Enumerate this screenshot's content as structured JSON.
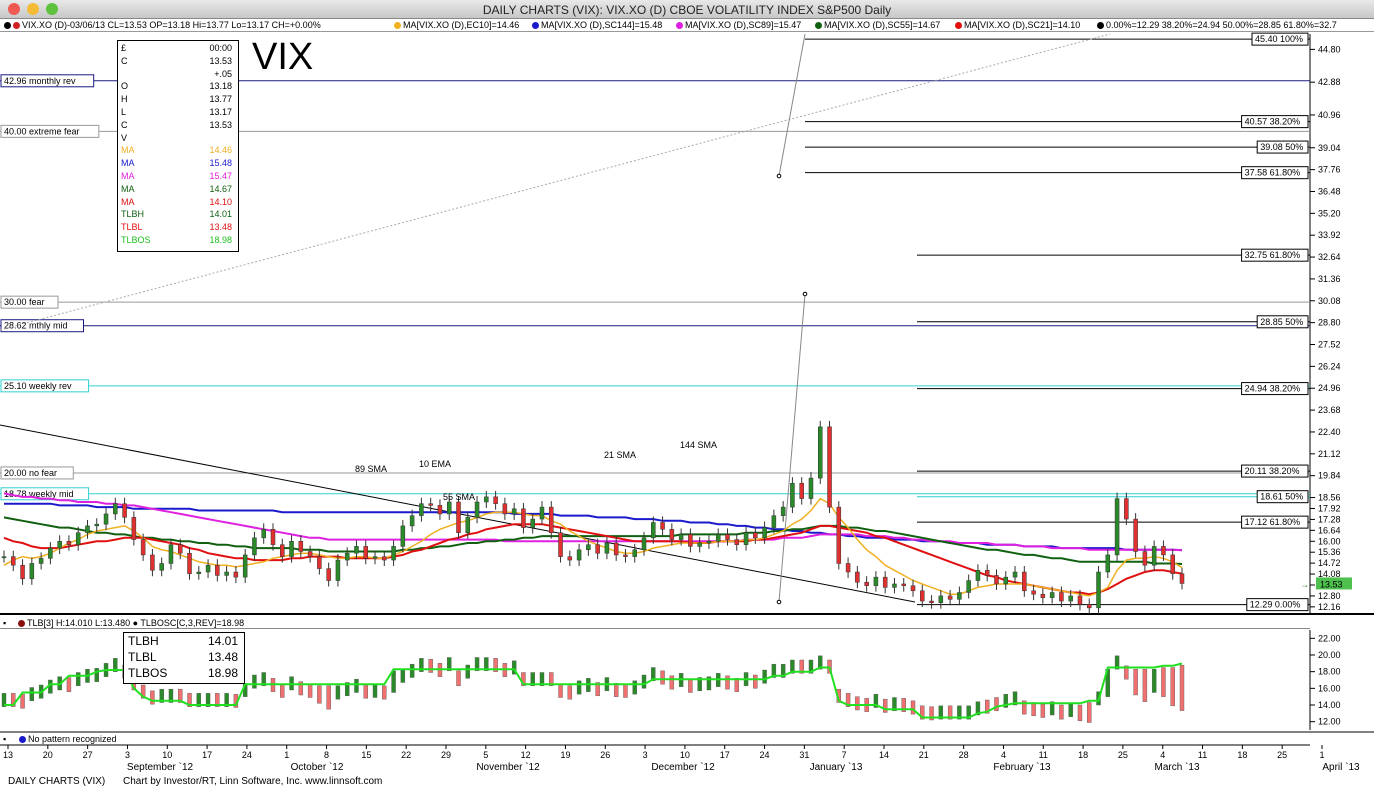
{
  "window": {
    "title": "DAILY CHARTS (VIX): VIX.XO (D) CBOE VOLATILITY INDEX S&P500 Daily"
  },
  "infobar": {
    "quote": "VIX.XO (D)-03/06/13 CL=13.53 OP=13.18 Hi=13.77 Lo=13.17 CH=+0.00%",
    "ma1": "MA[VIX.XO (D),EC10]=14.46",
    "ma2": "MA[VIX.XO (D),SC144]=15.48",
    "ma3": "MA[VIX.XO (D),SC89]=15.47",
    "ma4": "MA[VIX.XO (D),SC55]=14.67",
    "ma5": "MA[VIX.XO (D),SC21]=14.10",
    "fib": "0.00%=12.29 38.20%=24.94 50.00%=28.85 61.80%=32.7"
  },
  "big_label": "VIX",
  "data_panel": {
    "rows": [
      {
        "label": "£",
        "value": "00:00",
        "color": "#000000"
      },
      {
        "label": "C",
        "value": "13.53",
        "color": "#000000"
      },
      {
        "label": "",
        "value": "+.05",
        "color": "#000000"
      },
      {
        "label": "O",
        "value": "13.18",
        "color": "#000000"
      },
      {
        "label": "H",
        "value": "13.77",
        "color": "#000000"
      },
      {
        "label": "L",
        "value": "13.17",
        "color": "#000000"
      },
      {
        "label": "C",
        "value": "13.53",
        "color": "#000000"
      },
      {
        "label": "V",
        "value": "",
        "color": "#000000"
      },
      {
        "label": "MA",
        "value": "14.46",
        "color": "#f0b020"
      },
      {
        "label": "MA",
        "value": "15.48",
        "color": "#1a1acc"
      },
      {
        "label": "MA",
        "value": "15.47",
        "color": "#e020e0"
      },
      {
        "label": "MA",
        "value": "14.67",
        "color": "#106010"
      },
      {
        "label": "MA",
        "value": "14.10",
        "color": "#e01010"
      },
      {
        "label": "TLBH",
        "value": "14.01",
        "color": "#106010"
      },
      {
        "label": "TLBL",
        "value": "13.48",
        "color": "#e01010"
      },
      {
        "label": "TLBOS",
        "value": "18.98",
        "color": "#20c020"
      }
    ]
  },
  "sub_panel": {
    "header": "TLB[3] H:14.010 L:13.480 ● TLBOSC[C,3,REV]=18.98",
    "values": [
      {
        "label": "TLBH",
        "value": "14.01"
      },
      {
        "label": "TLBL",
        "value": "13.48"
      },
      {
        "label": "TLBOS",
        "value": "18.98"
      }
    ]
  },
  "pattern_status": "No pattern recognized",
  "footer": {
    "left": "DAILY CHARTS (VIX)",
    "credit": "Chart by Investor/RT, Linn Software, Inc. www.linnsoft.com"
  },
  "colors": {
    "up": "#2a8a2a",
    "down": "#e03030",
    "ma10": "#f0b020",
    "ma144": "#1a1acc",
    "ma89": "#e020e0",
    "ma55": "#106010",
    "ma21": "#e01010",
    "cyan": "#2fd0d0",
    "tlbos": "#20e020"
  },
  "chart_data": {
    "type": "candlestick",
    "title": "DAILY CHARTS (VIX): VIX.XO (D) CBOE VOLATILITY INDEX S&P500 Daily",
    "y_ticks": [
      "44.80",
      "42.88",
      "40.96",
      "39.04",
      "37.76",
      "36.48",
      "35.20",
      "33.92",
      "32.64",
      "31.36",
      "30.08",
      "28.80",
      "27.52",
      "26.24",
      "24.96",
      "23.68",
      "22.40",
      "21.12",
      "19.84",
      "18.56",
      "17.92",
      "17.28",
      "16.64",
      "16.00",
      "15.36",
      "14.72",
      "14.08",
      "13.44",
      "12.80",
      "12.16"
    ],
    "ylim": [
      11.8,
      45.7
    ],
    "last_value": "13.53",
    "x_day_ticks": [
      "13",
      "20",
      "27",
      "3",
      "10",
      "17",
      "24",
      "1",
      "8",
      "15",
      "22",
      "29",
      "5",
      "12",
      "19",
      "26",
      "3",
      "10",
      "17",
      "24",
      "31",
      "7",
      "14",
      "21",
      "28",
      "4",
      "11",
      "18",
      "25",
      "4",
      "11",
      "18",
      "25",
      "1"
    ],
    "x_month_labels": [
      "September `12",
      "October `12",
      "November `12",
      "December `12",
      "January `13",
      "February `13",
      "March `13",
      "April `13"
    ],
    "left_levels": [
      {
        "label": "42.96 monthly rev",
        "value": 42.96
      },
      {
        "label": "40.00 extreme fear",
        "value": 40.0
      },
      {
        "label": "30.00 fear",
        "value": 30.0
      },
      {
        "label": "28.62 mthly mid",
        "value": 28.62
      },
      {
        "label": "25.10 weekly rev",
        "value": 25.1
      },
      {
        "label": "20.00 no fear",
        "value": 20.0
      },
      {
        "label": "18.78 weekly mid",
        "value": 18.78
      }
    ],
    "fib_levels": [
      {
        "label": "45.40 100%",
        "value": 45.4
      },
      {
        "label": "40.57 38.20%",
        "value": 40.57
      },
      {
        "label": "39.08 50%",
        "value": 39.08
      },
      {
        "label": "37.58 61.80%",
        "value": 37.58
      },
      {
        "label": "32.75 61.80%",
        "value": 32.75
      },
      {
        "label": "28.85 50%",
        "value": 28.85
      },
      {
        "label": "24.94 38.20%",
        "value": 24.94
      },
      {
        "label": "20.11 38.20%",
        "value": 20.11
      },
      {
        "label": "18.61 50%",
        "value": 18.61
      },
      {
        "label": "17.12 61.80%",
        "value": 17.12
      },
      {
        "label": "12.29 0.00%",
        "value": 12.29
      }
    ],
    "annotations": [
      "89 SMA",
      "10 EMA",
      "55 SMA",
      "21 SMA",
      "144 SMA"
    ],
    "close_series": [
      15.1,
      14.6,
      13.8,
      14.7,
      15.0,
      15.6,
      16.0,
      15.8,
      16.5,
      16.9,
      17.0,
      17.6,
      18.2,
      17.4,
      16.1,
      15.2,
      14.3,
      14.7,
      15.8,
      15.3,
      14.1,
      14.2,
      14.6,
      14.0,
      14.2,
      13.9,
      15.2,
      16.2,
      16.7,
      15.8,
      15.1,
      16.0,
      15.4,
      15.1,
      14.4,
      13.7,
      14.9,
      15.3,
      15.7,
      15.0,
      15.1,
      14.9,
      15.7,
      16.9,
      17.5,
      18.2,
      18.1,
      17.6,
      18.3,
      16.5,
      17.4,
      18.3,
      18.6,
      18.2,
      17.6,
      17.9,
      16.8,
      17.3,
      18.0,
      16.5,
      15.1,
      14.9,
      15.5,
      15.8,
      15.3,
      15.9,
      15.2,
      15.1,
      15.5,
      16.2,
      17.1,
      16.7,
      16.1,
      16.4,
      15.7,
      15.9,
      16.0,
      16.4,
      16.1,
      15.8,
      16.5,
      16.2,
      16.8,
      17.5,
      18.0,
      19.4,
      18.5,
      19.7,
      22.7,
      18.0,
      14.7,
      14.2,
      13.6,
      13.4,
      13.9,
      13.3,
      13.5,
      13.4,
      13.1,
      12.5,
      12.4,
      12.8,
      12.6,
      13.0,
      13.7,
      14.3,
      14.0,
      13.5,
      13.9,
      14.2,
      13.1,
      12.9,
      12.7,
      13.0,
      12.5,
      12.8,
      12.3,
      12.1,
      14.2,
      15.2,
      18.5,
      17.3,
      15.4,
      14.6,
      15.7,
      15.2,
      14.1,
      13.53
    ],
    "ma10": [
      14.6,
      14.9,
      15.1,
      15.0,
      15.1,
      15.3,
      15.6,
      15.9,
      16.1,
      16.4,
      16.6,
      16.7,
      16.8,
      16.9,
      16.6,
      16.2,
      15.7,
      15.5,
      15.4,
      15.2,
      15.0,
      14.8,
      14.7,
      14.6,
      14.6,
      14.5,
      14.6,
      14.7,
      14.8,
      15.0,
      15.1,
      15.2,
      15.3,
      15.3,
      15.2,
      15.1,
      15.0,
      15.0,
      15.1,
      15.1,
      15.0,
      15.0,
      15.2,
      15.4,
      15.7,
      16.0,
      16.4,
      16.7,
      16.9,
      17.1,
      17.2,
      17.4,
      17.6,
      17.7,
      17.7,
      17.7,
      17.6,
      17.5,
      17.5,
      17.2,
      17.0,
      16.6,
      16.3,
      16.0,
      15.8,
      15.6,
      15.4,
      15.3,
      15.3,
      15.4,
      15.6,
      15.7,
      15.8,
      15.9,
      15.9,
      15.9,
      15.9,
      16.0,
      16.0,
      16.0,
      16.1,
      16.1,
      16.2,
      16.4,
      16.6,
      17.0,
      17.3,
      17.8,
      18.5,
      18.2,
      17.4,
      16.8,
      16.1,
      15.5,
      15.1,
      14.6,
      14.3,
      14.0,
      13.7,
      13.5,
      13.3,
      13.1,
      12.9,
      12.9,
      13.1,
      13.3,
      13.4,
      13.5,
      13.5,
      13.5,
      13.5,
      13.4,
      13.3,
      13.2,
      13.1,
      13.0,
      12.9,
      12.8,
      13.0,
      13.3,
      14.3,
      14.9,
      15.0,
      15.0,
      15.1,
      15.0,
      14.8,
      14.46
    ],
    "ma21": [
      16.2,
      16.0,
      15.9,
      15.7,
      15.6,
      15.6,
      15.6,
      15.7,
      15.8,
      15.9,
      16.0,
      16.0,
      16.1,
      16.2,
      16.2,
      16.2,
      16.1,
      16.0,
      15.9,
      15.8,
      15.6,
      15.5,
      15.3,
      15.2,
      15.1,
      15.0,
      15.0,
      14.9,
      14.9,
      14.9,
      14.9,
      15.0,
      15.0,
      15.1,
      15.1,
      15.1,
      15.1,
      15.0,
      15.0,
      15.0,
      15.0,
      15.0,
      15.1,
      15.2,
      15.4,
      15.5,
      15.7,
      15.9,
      16.1,
      16.2,
      16.4,
      16.5,
      16.7,
      16.8,
      16.9,
      17.0,
      17.0,
      17.0,
      17.0,
      16.9,
      16.8,
      16.7,
      16.6,
      16.5,
      16.4,
      16.3,
      16.2,
      16.1,
      16.0,
      16.0,
      16.0,
      16.0,
      16.0,
      16.0,
      15.9,
      15.9,
      15.9,
      16.0,
      16.0,
      16.0,
      16.0,
      16.1,
      16.1,
      16.2,
      16.3,
      16.4,
      16.5,
      16.7,
      16.9,
      16.9,
      16.8,
      16.7,
      16.6,
      16.5,
      16.3,
      16.2,
      16.0,
      15.8,
      15.6,
      15.4,
      15.2,
      15.0,
      14.8,
      14.6,
      14.4,
      14.2,
      14.0,
      13.9,
      13.7,
      13.6,
      13.5,
      13.4,
      13.3,
      13.2,
      13.1,
      13.0,
      13.0,
      12.9,
      13.0,
      13.2,
      13.5,
      13.8,
      14.0,
      14.2,
      14.3,
      14.3,
      14.2,
      14.1
    ],
    "ma55": [
      17.4,
      17.3,
      17.2,
      17.1,
      17.0,
      16.9,
      16.8,
      16.8,
      16.7,
      16.6,
      16.5,
      16.5,
      16.4,
      16.4,
      16.3,
      16.2,
      16.2,
      16.1,
      16.1,
      16.0,
      16.0,
      15.9,
      15.9,
      15.8,
      15.8,
      15.7,
      15.7,
      15.6,
      15.6,
      15.6,
      15.6,
      15.6,
      15.5,
      15.5,
      15.5,
      15.4,
      15.4,
      15.4,
      15.4,
      15.4,
      15.4,
      15.4,
      15.4,
      15.5,
      15.5,
      15.6,
      15.6,
      15.7,
      15.7,
      15.8,
      15.9,
      15.9,
      16.0,
      16.0,
      16.1,
      16.1,
      16.2,
      16.2,
      16.3,
      16.3,
      16.3,
      16.3,
      16.3,
      16.3,
      16.3,
      16.3,
      16.3,
      16.3,
      16.3,
      16.3,
      16.3,
      16.3,
      16.3,
      16.4,
      16.4,
      16.4,
      16.4,
      16.4,
      16.4,
      16.4,
      16.5,
      16.5,
      16.5,
      16.6,
      16.6,
      16.7,
      16.7,
      16.8,
      16.9,
      16.9,
      16.9,
      16.8,
      16.8,
      16.7,
      16.6,
      16.6,
      16.5,
      16.4,
      16.3,
      16.2,
      16.1,
      16.0,
      15.9,
      15.8,
      15.7,
      15.6,
      15.5,
      15.5,
      15.4,
      15.3,
      15.2,
      15.2,
      15.1,
      15.0,
      15.0,
      14.9,
      14.8,
      14.8,
      14.8,
      14.8,
      14.8,
      14.8,
      14.8,
      14.8,
      14.7,
      14.7,
      14.7,
      14.67
    ],
    "ma89": [
      18.8,
      18.7,
      18.6,
      18.6,
      18.5,
      18.5,
      18.4,
      18.4,
      18.3,
      18.3,
      18.3,
      18.2,
      18.2,
      18.1,
      18.1,
      18.0,
      17.9,
      17.8,
      17.7,
      17.6,
      17.5,
      17.4,
      17.3,
      17.2,
      17.1,
      17.0,
      16.9,
      16.8,
      16.7,
      16.6,
      16.5,
      16.4,
      16.3,
      16.2,
      16.2,
      16.1,
      16.1,
      16.1,
      16.1,
      16.1,
      16.1,
      16.1,
      16.1,
      16.1,
      16.1,
      16.1,
      16.1,
      16.1,
      16.1,
      16.1,
      16.1,
      16.1,
      16.1,
      16.1,
      16.0,
      16.0,
      16.0,
      16.0,
      16.0,
      16.0,
      16.0,
      16.0,
      16.0,
      16.0,
      16.0,
      16.0,
      16.0,
      16.0,
      16.0,
      16.0,
      16.0,
      16.0,
      16.0,
      16.0,
      16.0,
      16.0,
      16.0,
      16.0,
      16.0,
      16.0,
      16.1,
      16.1,
      16.1,
      16.1,
      16.2,
      16.2,
      16.2,
      16.3,
      16.4,
      16.4,
      16.4,
      16.4,
      16.4,
      16.3,
      16.3,
      16.3,
      16.2,
      16.2,
      16.1,
      16.1,
      16.0,
      16.0,
      16.0,
      15.9,
      15.9,
      15.9,
      15.9,
      15.8,
      15.8,
      15.8,
      15.7,
      15.7,
      15.7,
      15.6,
      15.6,
      15.6,
      15.6,
      15.5,
      15.5,
      15.5,
      15.5,
      15.5,
      15.5,
      15.5,
      15.5,
      15.5,
      15.5,
      15.47
    ],
    "ma144": [
      18.2,
      18.2,
      18.2,
      18.2,
      18.2,
      18.2,
      18.1,
      18.1,
      18.1,
      18.1,
      18.0,
      18.0,
      18.0,
      18.0,
      17.9,
      17.9,
      17.9,
      17.9,
      17.9,
      17.9,
      17.9,
      17.8,
      17.8,
      17.8,
      17.8,
      17.8,
      17.8,
      17.8,
      17.8,
      17.8,
      17.7,
      17.7,
      17.7,
      17.7,
      17.7,
      17.7,
      17.7,
      17.7,
      17.7,
      17.7,
      17.7,
      17.7,
      17.7,
      17.7,
      17.7,
      17.7,
      17.7,
      17.7,
      17.7,
      17.7,
      17.7,
      17.7,
      17.7,
      17.7,
      17.7,
      17.6,
      17.6,
      17.6,
      17.6,
      17.6,
      17.5,
      17.5,
      17.5,
      17.5,
      17.4,
      17.4,
      17.4,
      17.4,
      17.3,
      17.3,
      17.3,
      17.2,
      17.2,
      17.2,
      17.1,
      17.1,
      17.1,
      17.0,
      17.0,
      16.9,
      16.9,
      16.8,
      16.8,
      16.7,
      16.7,
      16.6,
      16.6,
      16.5,
      16.5,
      16.4,
      16.4,
      16.3,
      16.3,
      16.2,
      16.2,
      16.2,
      16.1,
      16.1,
      16.1,
      16.0,
      16.0,
      16.0,
      15.9,
      15.9,
      15.9,
      15.9,
      15.8,
      15.8,
      15.8,
      15.8,
      15.7,
      15.7,
      15.7,
      15.7,
      15.6,
      15.6,
      15.6,
      15.6,
      15.6,
      15.6,
      15.6,
      15.5,
      15.5,
      15.5,
      15.5,
      15.5,
      15.5,
      15.48
    ],
    "tlb_y_ticks": [
      "22.00",
      "20.00",
      "18.00",
      "16.00",
      "14.00",
      "12.00"
    ],
    "tlb_ylim": [
      11.0,
      23.0
    ],
    "tlbos_series": [
      14.0,
      14.0,
      15.5,
      15.5,
      15.5,
      16.5,
      16.5,
      17.5,
      17.5,
      17.5,
      18.0,
      18.2,
      18.2,
      18.2,
      16.0,
      15.0,
      14.5,
      14.5,
      14.5,
      14.5,
      14.0,
      14.0,
      14.0,
      14.0,
      14.0,
      14.0,
      16.5,
      16.5,
      16.5,
      16.5,
      16.5,
      16.5,
      16.5,
      16.5,
      16.5,
      16.5,
      16.5,
      16.5,
      16.5,
      16.5,
      16.5,
      16.5,
      18.3,
      18.3,
      18.3,
      18.3,
      18.3,
      18.3,
      18.3,
      18.3,
      18.3,
      18.3,
      18.3,
      18.3,
      18.3,
      18.3,
      16.5,
      16.5,
      16.5,
      16.5,
      16.5,
      16.5,
      16.5,
      16.5,
      16.5,
      16.5,
      16.5,
      16.5,
      16.5,
      16.5,
      17.1,
      17.1,
      17.1,
      17.1,
      17.1,
      17.1,
      17.1,
      17.1,
      17.1,
      17.1,
      17.1,
      17.1,
      17.1,
      17.5,
      17.5,
      18.0,
      18.0,
      18.0,
      18.5,
      18.5,
      14.5,
      14.0,
      14.0,
      14.0,
      14.0,
      13.5,
      13.5,
      13.5,
      13.5,
      12.5,
      12.5,
      12.5,
      12.5,
      12.5,
      12.5,
      13.0,
      13.2,
      13.8,
      14.0,
      14.2,
      14.2,
      14.2,
      14.2,
      14.2,
      14.2,
      14.2,
      14.2,
      14.5,
      14.5,
      18.5,
      18.5,
      18.5,
      18.5,
      18.5,
      18.5,
      18.7,
      18.7,
      18.98
    ]
  }
}
